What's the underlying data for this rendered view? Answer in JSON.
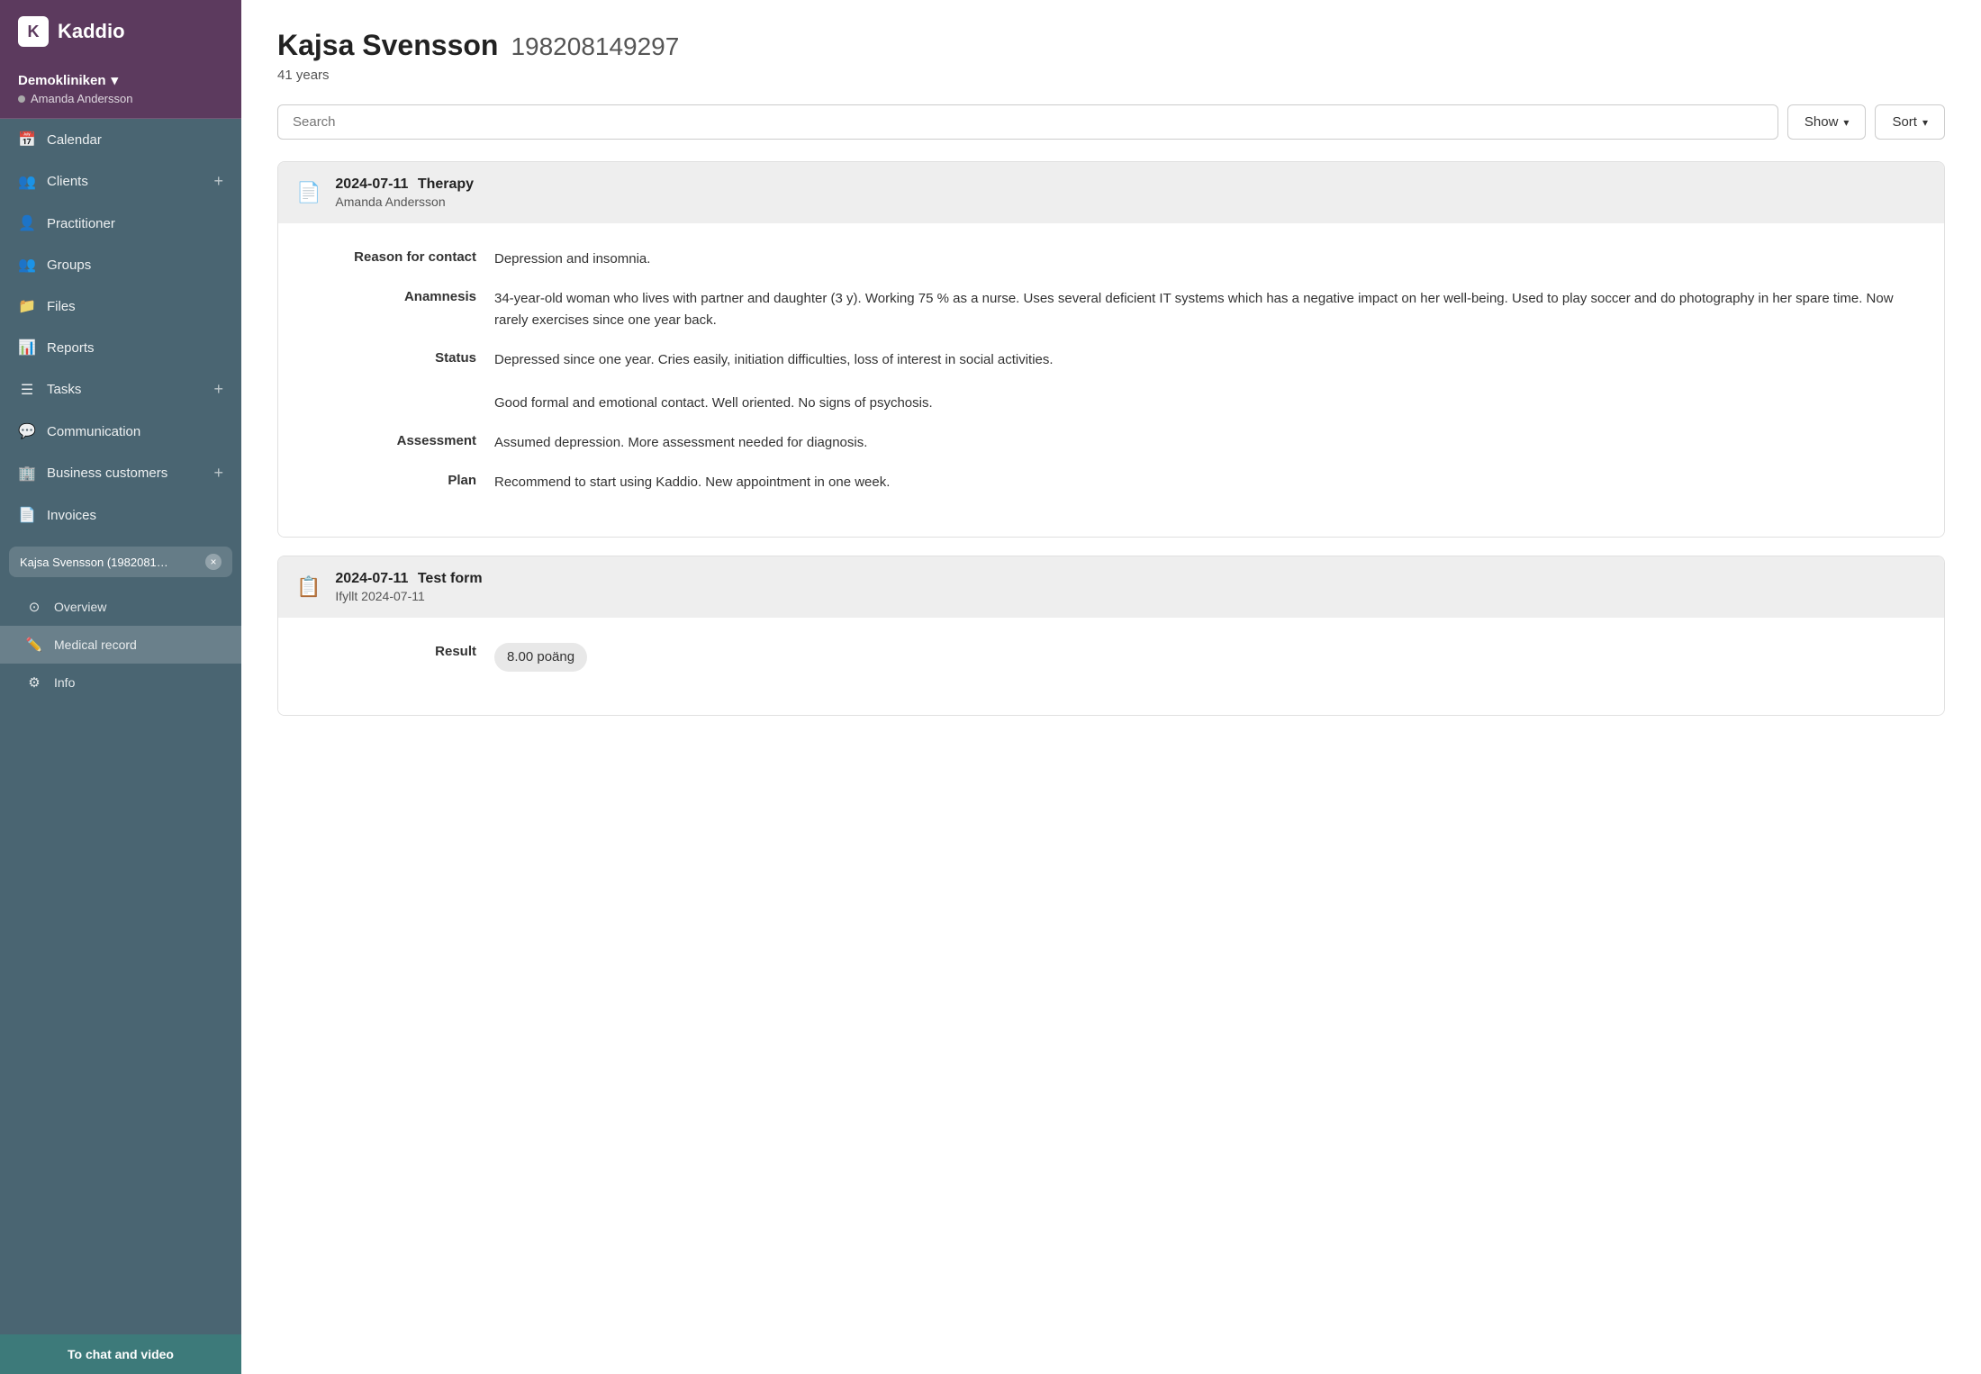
{
  "app": {
    "logo_letter": "K",
    "logo_name": "Kaddio"
  },
  "sidebar": {
    "clinic_name": "Demokliniken",
    "clinic_chevron": "▾",
    "user_name": "Amanda Andersson",
    "nav_items": [
      {
        "id": "calendar",
        "icon": "📅",
        "label": "Calendar",
        "has_plus": false
      },
      {
        "id": "clients",
        "icon": "👥",
        "label": "Clients",
        "has_plus": true
      },
      {
        "id": "practitioner",
        "icon": "👤",
        "label": "Practitioner",
        "has_plus": false
      },
      {
        "id": "groups",
        "icon": "👥",
        "label": "Groups",
        "has_plus": false
      },
      {
        "id": "files",
        "icon": "📁",
        "label": "Files",
        "has_plus": false
      },
      {
        "id": "reports",
        "icon": "📊",
        "label": "Reports",
        "has_plus": false
      },
      {
        "id": "tasks",
        "icon": "☰",
        "label": "Tasks",
        "has_plus": true
      },
      {
        "id": "communication",
        "icon": "💬",
        "label": "Communication",
        "has_plus": false
      },
      {
        "id": "business-customers",
        "icon": "🏢",
        "label": "Business customers",
        "has_plus": true
      },
      {
        "id": "invoices",
        "icon": "📄",
        "label": "Invoices",
        "has_plus": false
      }
    ],
    "patient_tab": {
      "label": "Kajsa Svensson (1982081…",
      "close": "×"
    },
    "sub_items": [
      {
        "id": "overview",
        "icon": "⊙",
        "label": "Overview",
        "active": false
      },
      {
        "id": "medical-record",
        "icon": "✏️",
        "label": "Medical record",
        "active": true
      },
      {
        "id": "info",
        "icon": "⚙",
        "label": "Info",
        "active": false
      }
    ],
    "chat_button": "To chat and video"
  },
  "patient": {
    "name": "Kajsa Svensson",
    "id_number": "198208149297",
    "age": "41 years"
  },
  "toolbar": {
    "search_placeholder": "Search",
    "show_label": "Show",
    "sort_label": "Sort"
  },
  "records": [
    {
      "id": "therapy-record",
      "date": "2024-07-11",
      "type": "Therapy",
      "author": "Amanda Andersson",
      "icon": "📄",
      "fields": [
        {
          "label": "Reason for contact",
          "value": "Depression and insomnia."
        },
        {
          "label": "Anamnesis",
          "value": "34-year-old woman who lives with partner and daughter (3 y). Working 75 % as a nurse. Uses several deficient IT systems which has a negative impact on her well-being. Used to play soccer and do photography in her spare time. Now rarely exercises since one year back."
        },
        {
          "label": "Status",
          "value": "Depressed since one year. Cries easily, initiation difficulties, loss of interest in social activities.\n\nGood formal and emotional contact. Well oriented. No signs of psychosis."
        },
        {
          "label": "Assessment",
          "value": "Assumed depression. More assessment needed for diagnosis."
        },
        {
          "label": "Plan",
          "value": "Recommend to start using Kaddio. New appointment in one week."
        }
      ]
    },
    {
      "id": "test-form-record",
      "date": "2024-07-11",
      "type": "Test form",
      "author": "Ifyllt 2024-07-11",
      "icon": "📋",
      "fields": [
        {
          "label": "Result",
          "value": "8.00 poäng",
          "is_badge": true
        }
      ]
    }
  ]
}
